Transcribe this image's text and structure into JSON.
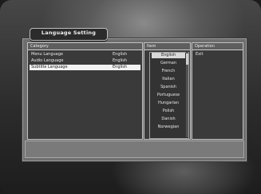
{
  "window": {
    "title": "Language Setting"
  },
  "category_panel": {
    "header": "Category",
    "rows": [
      {
        "label": "Menu Language",
        "value": "English",
        "selected": false
      },
      {
        "label": "Audio Language",
        "value": "English",
        "selected": false
      },
      {
        "label": "Subtitle Language",
        "value": "English",
        "selected": true
      }
    ]
  },
  "item_panel": {
    "header": "Item",
    "items": [
      {
        "label": "English",
        "selected": true
      },
      {
        "label": "German"
      },
      {
        "label": "French"
      },
      {
        "label": "Italian"
      },
      {
        "label": "Spanish"
      },
      {
        "label": "Portuguese"
      },
      {
        "label": "Hungarian"
      },
      {
        "label": "Polish"
      },
      {
        "label": "Danish"
      },
      {
        "label": "Norwegian"
      }
    ]
  },
  "operation_panel": {
    "header": "Operation",
    "rows": [
      {
        "label": "Exit"
      }
    ]
  },
  "colors": {
    "frame": "#6e6e6e",
    "panel": "#3a3a3a",
    "highlight": "#f2f2f2",
    "text": "#e8e8e8"
  }
}
